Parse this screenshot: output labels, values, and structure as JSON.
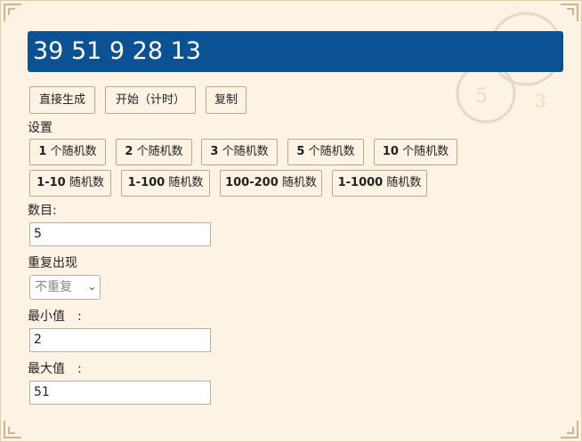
{
  "result": "39 51 9 28 13",
  "actions": {
    "generate": "直接生成",
    "start": "开始（计时）",
    "copy": "复制"
  },
  "settings_label": "设置",
  "count_presets": [
    {
      "num": "1",
      "text": " 个随机数"
    },
    {
      "num": "2",
      "text": " 个随机数"
    },
    {
      "num": "3",
      "text": " 个随机数"
    },
    {
      "num": "5",
      "text": " 个随机数"
    },
    {
      "num": "10",
      "text": " 个随机数"
    }
  ],
  "range_presets": [
    {
      "num": "1-10",
      "text": " 随机数"
    },
    {
      "num": "1-100",
      "text": " 随机数"
    },
    {
      "num": "100-200",
      "text": " 随机数"
    },
    {
      "num": "1-1000",
      "text": " 随机数"
    }
  ],
  "form": {
    "count_label": "数目:",
    "count_value": "5",
    "repeat_label": "重复出现",
    "repeat_selected": "不重复",
    "min_label": "最小值　:",
    "min_value": "2",
    "max_label": "最大值　:",
    "max_value": "51"
  },
  "colors": {
    "background": "#fdf3e4",
    "result_bg": "#0b5294"
  }
}
